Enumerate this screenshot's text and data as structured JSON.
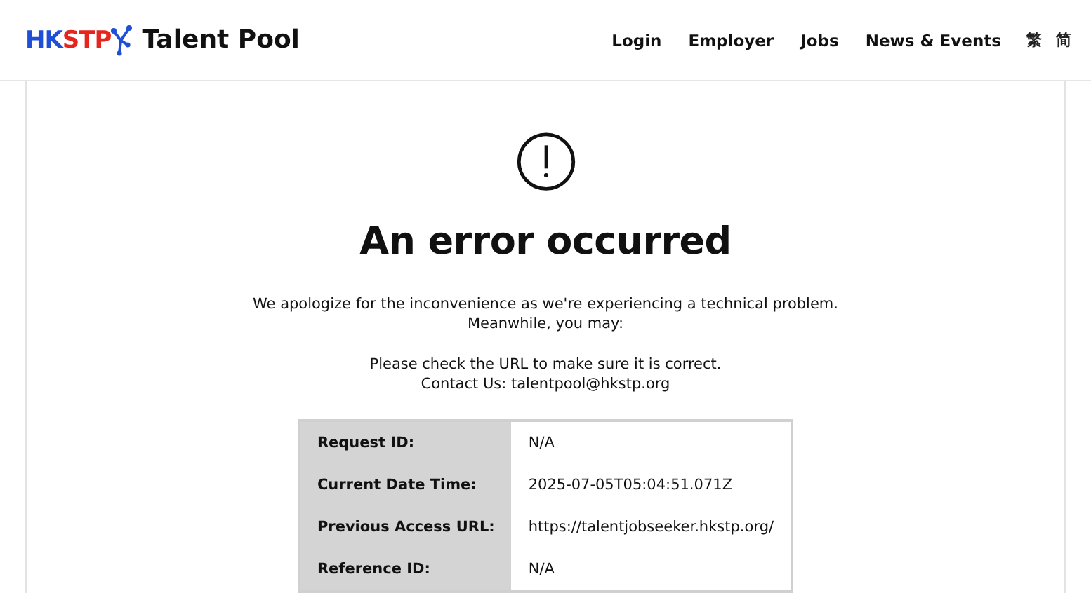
{
  "header": {
    "logo_parts": [
      {
        "text": "HK",
        "color": "#1f4fd6"
      },
      {
        "text": "STP",
        "color": "#e5261f"
      }
    ],
    "site_name": "Talent Pool",
    "nav": [
      {
        "label": "Login"
      },
      {
        "label": "Employer"
      },
      {
        "label": "Jobs"
      },
      {
        "label": "News & Events"
      }
    ],
    "languages": [
      {
        "label": "繁"
      },
      {
        "label": "简"
      }
    ]
  },
  "error": {
    "title": "An error occurred",
    "message_lines": [
      "We apologize for the inconvenience as we're experiencing a technical problem.",
      "Meanwhile, you may:"
    ],
    "tips": [
      "Please check the URL to make sure it is correct.",
      "Contact Us:  talentpool@hkstp.org"
    ],
    "details": [
      {
        "label": "Request ID:",
        "value": "N/A"
      },
      {
        "label": "Current Date Time:",
        "value": "2025-07-05T05:04:51.071Z"
      },
      {
        "label": "Previous Access URL:",
        "value": "https://talentjobseeker.hkstp.org/"
      },
      {
        "label": "Reference ID:",
        "value": "N/A"
      }
    ]
  }
}
